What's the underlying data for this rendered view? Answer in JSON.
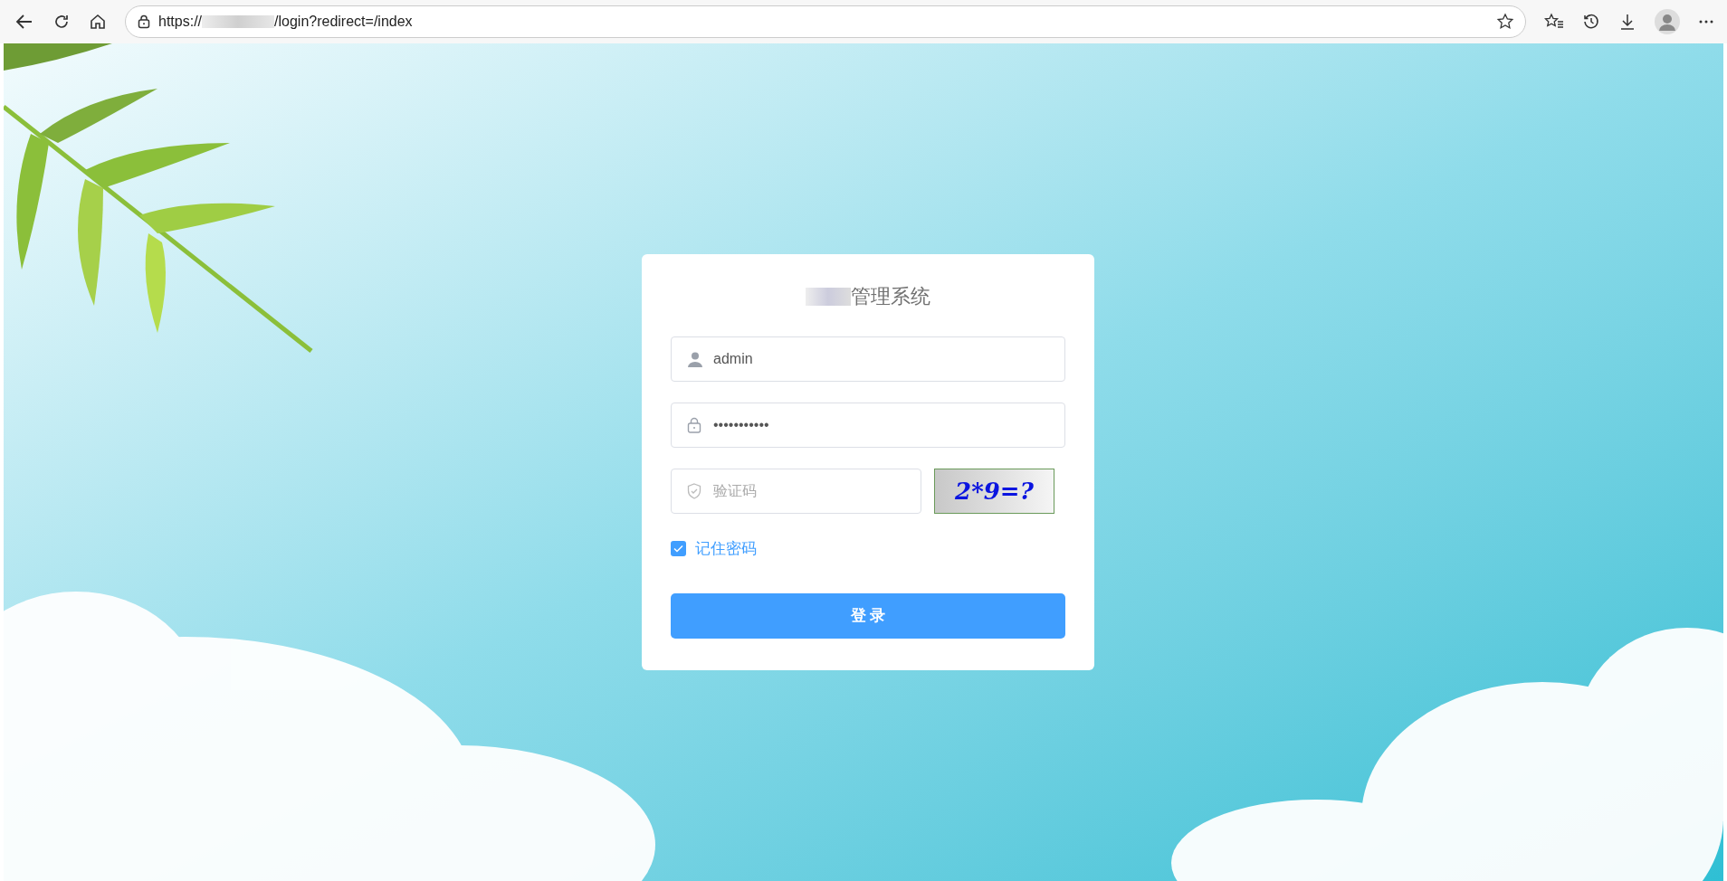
{
  "browser": {
    "url_prefix": "https://",
    "url_suffix": "/login?redirect=/index"
  },
  "login": {
    "title": "管理系统",
    "fields": [
      {
        "kind": "username",
        "value": "admin"
      },
      {
        "kind": "password",
        "value": "•••••••••••"
      },
      {
        "kind": "captcha",
        "placeholder": "验证码"
      }
    ],
    "captcha_image": "2*9=?",
    "remember": {
      "label": "记住密码",
      "checked": true
    },
    "submit": "登 录"
  }
}
